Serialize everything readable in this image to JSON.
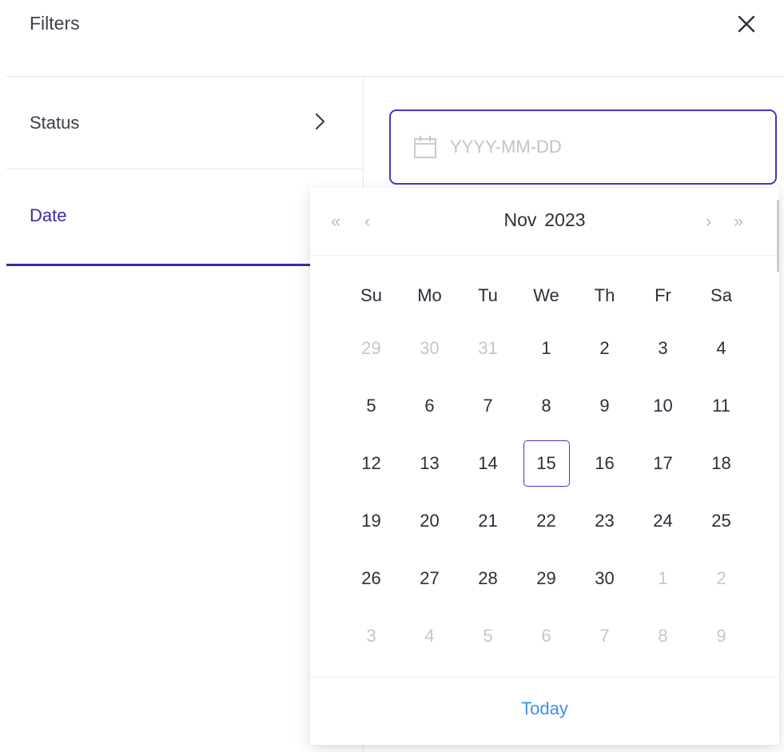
{
  "header": {
    "title": "Filters",
    "close_icon": "close-icon"
  },
  "sidebar": {
    "items": [
      {
        "label": "Status",
        "icon": "chevron-right-icon"
      },
      {
        "label": "Date"
      }
    ]
  },
  "date_input": {
    "placeholder": "YYYY-MM-DD",
    "value": "",
    "icon": "calendar-icon"
  },
  "calendar": {
    "month": "Nov",
    "year": "2023",
    "prev_year_glyph": "«",
    "prev_month_glyph": "‹",
    "next_month_glyph": "›",
    "next_year_glyph": "»",
    "weekdays": [
      "Su",
      "Mo",
      "Tu",
      "We",
      "Th",
      "Fr",
      "Sa"
    ],
    "days": [
      [
        "29",
        "30",
        "31",
        "1",
        "2",
        "3",
        "4"
      ],
      [
        "5",
        "6",
        "7",
        "8",
        "9",
        "10",
        "11"
      ],
      [
        "12",
        "13",
        "14",
        "15",
        "16",
        "17",
        "18"
      ],
      [
        "19",
        "20",
        "21",
        "22",
        "23",
        "24",
        "25"
      ],
      [
        "26",
        "27",
        "28",
        "29",
        "30",
        "1",
        "2"
      ],
      [
        "3",
        "4",
        "5",
        "6",
        "7",
        "8",
        "9"
      ]
    ],
    "out_of_month": [
      [
        true,
        true,
        true,
        false,
        false,
        false,
        false
      ],
      [
        false,
        false,
        false,
        false,
        false,
        false,
        false
      ],
      [
        false,
        false,
        false,
        false,
        false,
        false,
        false
      ],
      [
        false,
        false,
        false,
        false,
        false,
        false,
        false
      ],
      [
        false,
        false,
        false,
        false,
        false,
        true,
        true
      ],
      [
        true,
        true,
        true,
        true,
        true,
        true,
        true
      ]
    ],
    "today": "15",
    "footer_label": "Today"
  },
  "colors": {
    "accent": "#4a35c8",
    "active_tab": "#3b2aa8",
    "link": "#3d8ff6",
    "muted": "#c4c6cb"
  }
}
